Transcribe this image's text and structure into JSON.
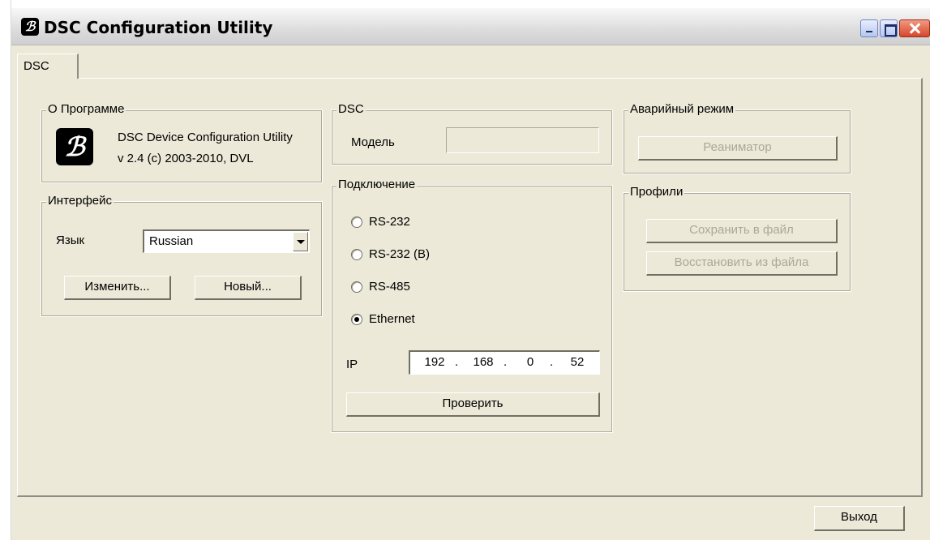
{
  "window": {
    "title": "DSC Configuration Utility",
    "icon": "app-logo-icon",
    "controls": [
      "minimize",
      "maximize",
      "close"
    ]
  },
  "tabs": [
    {
      "label": "DSC",
      "active": true
    }
  ],
  "about": {
    "title": "О Программе",
    "line1": "DSC Device Configuration Utility",
    "line2": "v 2.4  (c) 2003-2010, DVL"
  },
  "interface": {
    "title": "Интерфейс",
    "language_label": "Язык",
    "language_value": "Russian",
    "change_button": "Изменить...",
    "new_button": "Новый..."
  },
  "dsc": {
    "title": "DSC",
    "model_label": "Модель",
    "model_value": ""
  },
  "connection": {
    "title": "Подключение",
    "options": [
      {
        "label": "RS-232",
        "checked": false
      },
      {
        "label": "RS-232 (B)",
        "checked": false
      },
      {
        "label": "RS-485",
        "checked": false
      },
      {
        "label": "Ethernet",
        "checked": true
      }
    ],
    "ip_label": "IP",
    "ip": [
      "192",
      "168",
      "0",
      "52"
    ],
    "check_button": "Проверить"
  },
  "emergency": {
    "title": "Аварийный режим",
    "reanimator_button": "Реаниматор"
  },
  "profiles": {
    "title": "Профили",
    "save_button": "Сохранить в файл",
    "restore_button": "Восстановить из файла"
  },
  "footer": {
    "exit_button": "Выход"
  }
}
